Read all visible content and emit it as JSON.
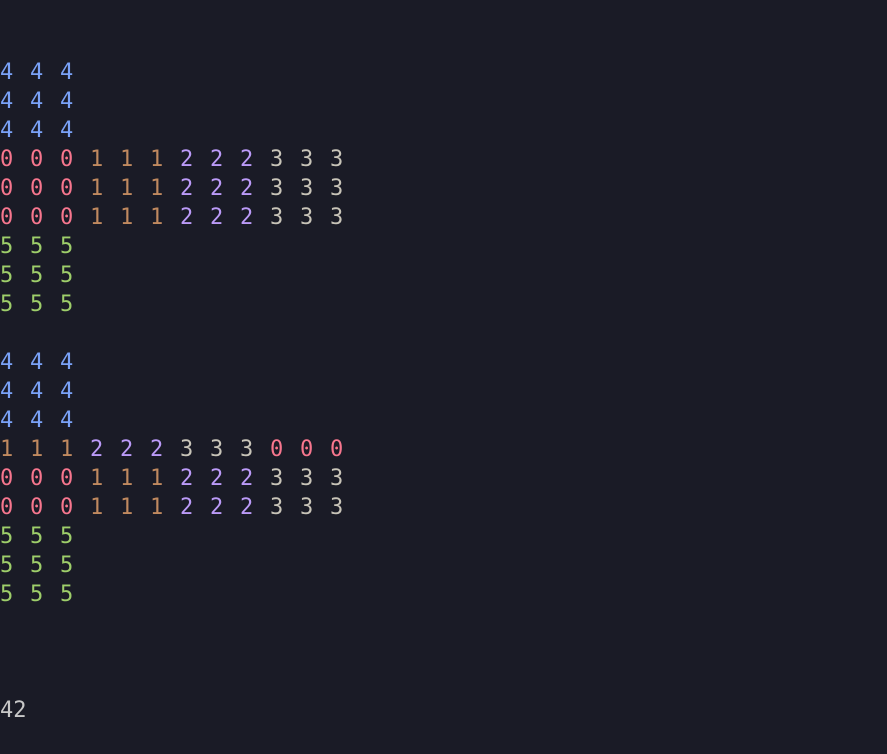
{
  "colors": {
    "background": "#1a1b26",
    "0": "#f7768e",
    "1": "#c0895f",
    "2": "#bb9af7",
    "3": "#c8c4b8",
    "4": "#7aa2f7",
    "5": "#9ece6a",
    "output": "#c8c8c8"
  },
  "terminal": {
    "lines": [
      [
        "4",
        "4",
        "4"
      ],
      [
        "4",
        "4",
        "4"
      ],
      [
        "4",
        "4",
        "4"
      ],
      [
        "0",
        "0",
        "0",
        "1",
        "1",
        "1",
        "2",
        "2",
        "2",
        "3",
        "3",
        "3"
      ],
      [
        "0",
        "0",
        "0",
        "1",
        "1",
        "1",
        "2",
        "2",
        "2",
        "3",
        "3",
        "3"
      ],
      [
        "0",
        "0",
        "0",
        "1",
        "1",
        "1",
        "2",
        "2",
        "2",
        "3",
        "3",
        "3"
      ],
      [
        "5",
        "5",
        "5"
      ],
      [
        "5",
        "5",
        "5"
      ],
      [
        "5",
        "5",
        "5"
      ],
      [],
      [
        "4",
        "4",
        "4"
      ],
      [
        "4",
        "4",
        "4"
      ],
      [
        "4",
        "4",
        "4"
      ],
      [
        "1",
        "1",
        "1",
        "2",
        "2",
        "2",
        "3",
        "3",
        "3",
        "0",
        "0",
        "0"
      ],
      [
        "0",
        "0",
        "0",
        "1",
        "1",
        "1",
        "2",
        "2",
        "2",
        "3",
        "3",
        "3"
      ],
      [
        "0",
        "0",
        "0",
        "1",
        "1",
        "1",
        "2",
        "2",
        "2",
        "3",
        "3",
        "3"
      ],
      [
        "5",
        "5",
        "5"
      ],
      [
        "5",
        "5",
        "5"
      ],
      [
        "5",
        "5",
        "5"
      ],
      []
    ],
    "output": "42"
  }
}
